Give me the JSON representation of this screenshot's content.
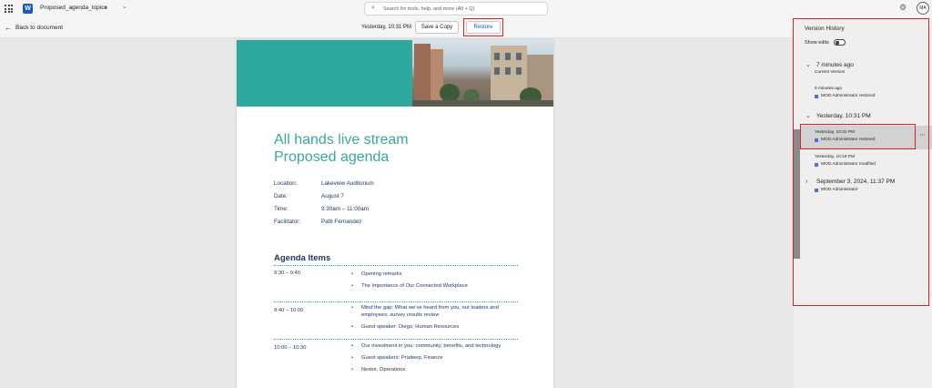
{
  "app": {
    "doc_title": "Proposed_agenda_topics",
    "logo_letter": "W",
    "search_placeholder": "Search for tools, help, and more (Alt + Q)",
    "avatar_initials": "MA"
  },
  "command_bar": {
    "back_label": "Back to document",
    "version_time": "Yesterday, 10:31 PM",
    "save_copy_label": "Save a Copy",
    "restore_label": "Restore"
  },
  "document": {
    "heading_line1": "All hands live stream",
    "heading_line2": "Proposed agenda",
    "info": [
      {
        "label": "Location:",
        "value": "Lakeview Auditorium"
      },
      {
        "label": "Date:",
        "value": "August 7"
      },
      {
        "label": "Time:",
        "value": "9:30am – 11:00am"
      },
      {
        "label": "Facilitator:",
        "value": "Patti Fernandez"
      }
    ],
    "agenda_title": "Agenda Items",
    "agenda": [
      {
        "time": "9:30 – 9:40",
        "items": [
          "Opening remarks",
          "The Importance of Our Connected Workplace"
        ]
      },
      {
        "time": "9:40 – 10:00",
        "items": [
          "Mind the gap: What we’ve heard from you, our leaders and employees; survey results review",
          "Guest speaker: Diego, Human Resources"
        ]
      },
      {
        "time": "10:00 – 10:30",
        "items": [
          "Our investment in you: community, benefits, and technology",
          "Guest speakers: Pradeep, Finance",
          "Nestor, Operations"
        ]
      }
    ]
  },
  "version_history": {
    "title": "Version History",
    "show_edits_label": "Show edits",
    "groups": [
      {
        "label": "7 minutes ago",
        "sub": "Current Version"
      },
      {
        "label": "Yesterday, 10:31 PM"
      },
      {
        "label": "September 3, 2024, 11:37 PM",
        "sub": "MOD Administrator"
      }
    ],
    "entries": [
      {
        "time": "6 minutes ago",
        "user": "MOD Administrator restored"
      },
      {
        "time": "Yesterday, 10:31 PM",
        "user": "MOD Administrator restored"
      },
      {
        "time": "Yesterday, 10:19 PM",
        "user": "MOD Administrator modified"
      }
    ],
    "more_label": "⋯"
  },
  "colors": {
    "accent_teal": "#2fa99f",
    "heading_teal": "#3aa89e",
    "navy_text": "#1f3864",
    "highlight_red": "#d9212c",
    "word_blue": "#185abd"
  }
}
